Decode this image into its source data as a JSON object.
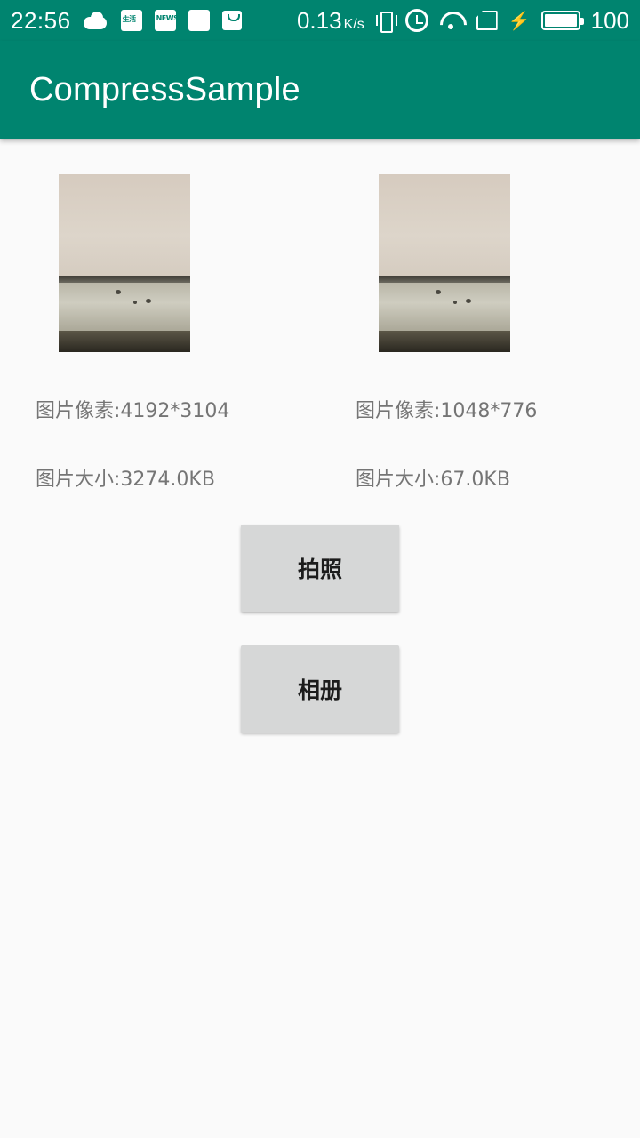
{
  "status_bar": {
    "time": "22:56",
    "news_badge": "NEWS",
    "life_badge": "生活",
    "net_speed": "0.13",
    "net_unit": "K/s",
    "battery_level": "100",
    "icons": [
      "cloud-icon",
      "life-app-icon",
      "news-app-icon",
      "reader-app-icon",
      "shop-bag-icon",
      "vibrate-icon",
      "alarm-icon",
      "wifi-icon",
      "sim-icon",
      "charging-icon",
      "battery-icon"
    ],
    "accent_color": "#00846f"
  },
  "app_bar": {
    "title": "CompressSample",
    "color": "#00846f"
  },
  "original": {
    "pixels": "图片像素:4192*3104",
    "size": "图片大小:3274.0KB"
  },
  "compressed": {
    "pixels": "图片像素:1048*776",
    "size": "图片大小:67.0KB"
  },
  "buttons": {
    "camera_label": "拍照",
    "album_label": "相册"
  }
}
